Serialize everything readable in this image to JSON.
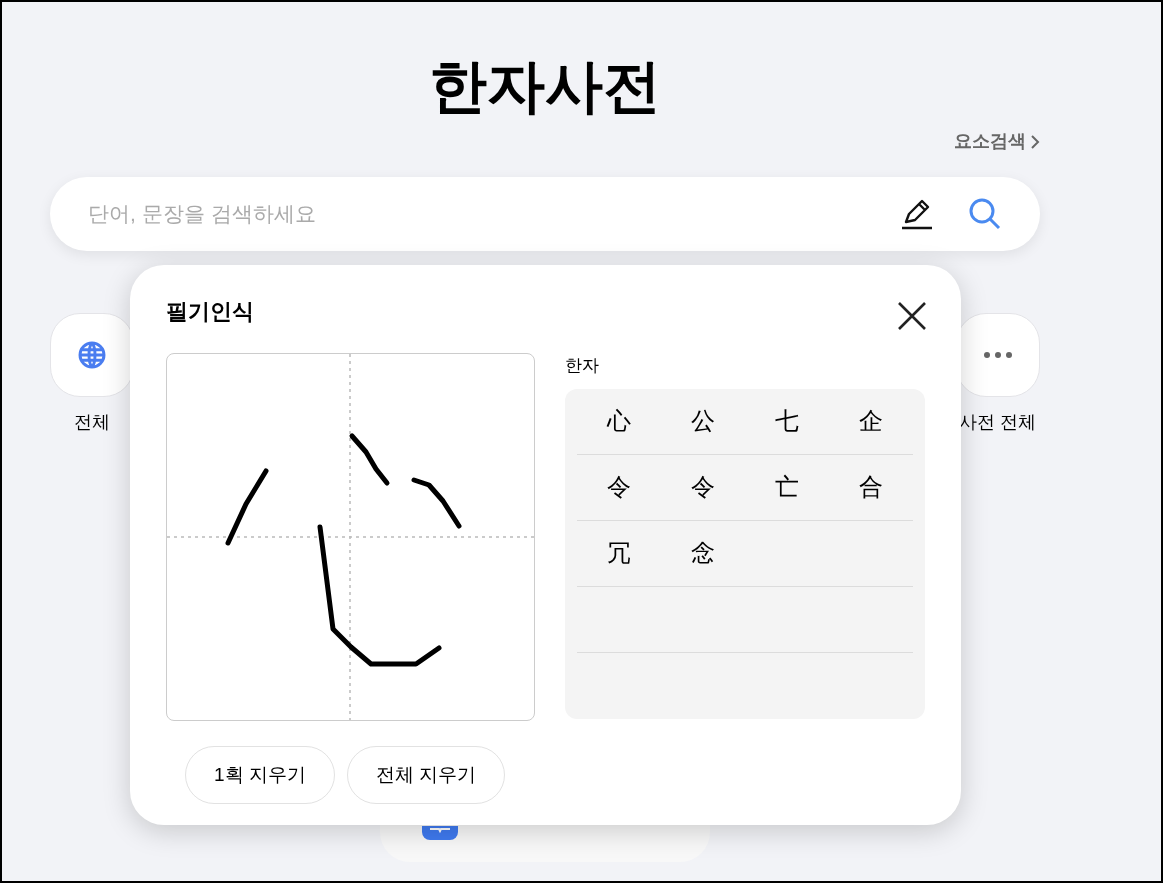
{
  "page": {
    "title": "한자사전",
    "element_search_link": "요소검색"
  },
  "search": {
    "placeholder": "단어, 문장을 검색하세요"
  },
  "categories": [
    {
      "kind": "globe",
      "label": "전체"
    },
    {
      "kind": "more",
      "label": "사전 전체"
    }
  ],
  "handwriting_popup": {
    "title": "필기인식",
    "result_label": "한자",
    "candidates": [
      "心",
      "公",
      "七",
      "企",
      "令",
      "令",
      "亡",
      "合",
      "冗",
      "念"
    ],
    "buttons": [
      "1획 지우기",
      "전체 지우기"
    ]
  }
}
